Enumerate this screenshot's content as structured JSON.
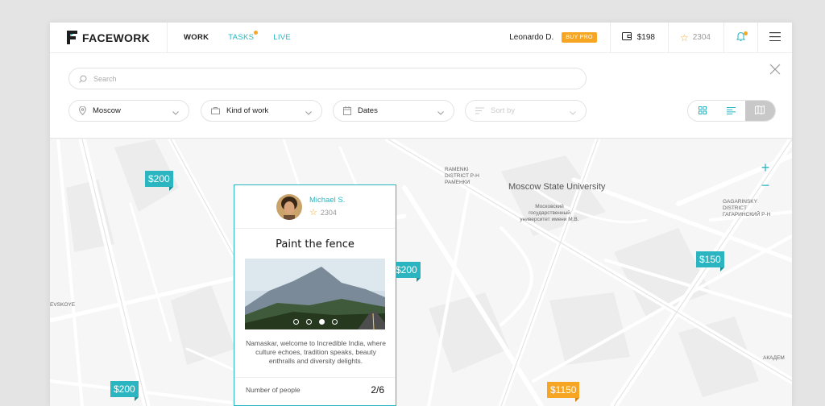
{
  "header": {
    "brand": "FACEWORK",
    "nav": [
      {
        "label": "WORK"
      },
      {
        "label": "TASKS"
      },
      {
        "label": "LIVE"
      }
    ],
    "user_name": "Leonardo D.",
    "pro_badge": "BUY PRO",
    "balance": "$198",
    "rating": "2304"
  },
  "filters": {
    "search_placeholder": "Search",
    "location": "Moscow",
    "kind_of_work": "Kind of work",
    "dates": "Dates",
    "sort_by": "Sort by"
  },
  "map": {
    "labels": {
      "moscow_state_university": "Moscow State University",
      "msu_ru": "Московский государственный университет имени М.В.",
      "ramenki": "RAMENKI DISTRICT Р-Н РАМЕНКИ",
      "gagarinsky": "GAGARINSKY DISTRICT ГАГАРИНСКИЙ Р-Н",
      "evskoye": "EVSKOYE",
      "akadem": "АКАДЕМ"
    },
    "price_tags": [
      {
        "label": "$200"
      },
      {
        "label": "$200"
      },
      {
        "label": "$150"
      },
      {
        "label": "$200"
      },
      {
        "label": "$1150"
      }
    ]
  },
  "card": {
    "author": "Michael S.",
    "author_rating": "2304",
    "title": "Paint the fence",
    "description": "Namaskar, welcome to Incredible India, where culture echoes, tradition speaks, beauty enthralls and diversity delights.",
    "slides_total": 4,
    "slide_active": 3,
    "row_label": "Number of people",
    "row_value": "2/6"
  },
  "colors": {
    "accent": "#2bb5c1",
    "orange": "#f6a623"
  }
}
